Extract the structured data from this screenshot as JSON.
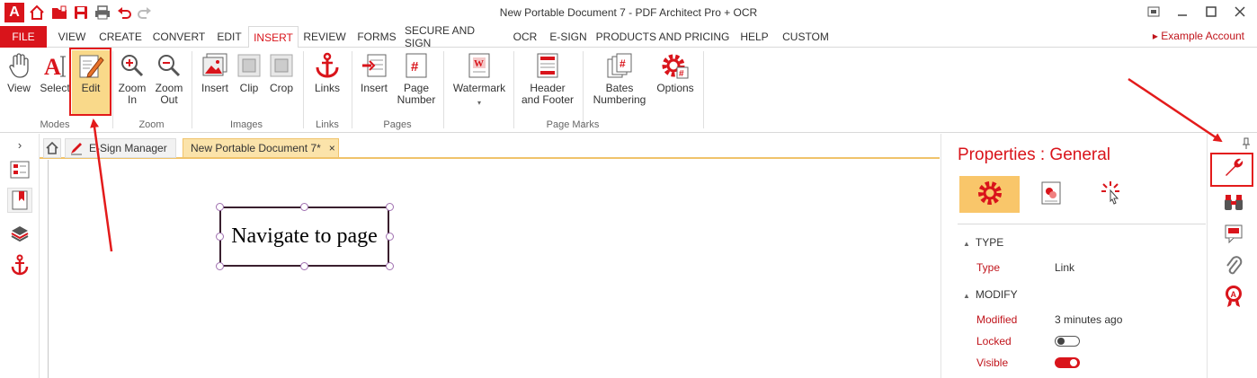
{
  "window": {
    "title": "New Portable Document 7    -   PDF Architect Pro + OCR",
    "logo_letter": "A"
  },
  "menu": {
    "file_label": "FILE",
    "tabs": [
      "VIEW",
      "CREATE",
      "CONVERT",
      "EDIT",
      "INSERT",
      "REVIEW",
      "FORMS",
      "SECURE AND SIGN",
      "OCR",
      "E-SIGN",
      "PRODUCTS AND PRICING",
      "HELP",
      "CUSTOM"
    ],
    "active_tab": "INSERT",
    "account_label": "▸ Example Account"
  },
  "ribbon": {
    "buttons": {
      "view": "View",
      "select": "Select",
      "edit": "Edit",
      "zoom_in_1": "Zoom",
      "zoom_in_2": "In",
      "zoom_out_1": "Zoom",
      "zoom_out_2": "Out",
      "insert_image": "Insert",
      "clip": "Clip",
      "crop": "Crop",
      "links": "Links",
      "insert_page": "Insert",
      "page_number_1": "Page",
      "page_number_2": "Number",
      "watermark": "Watermark",
      "header_footer_1": "Header",
      "header_footer_2": "and Footer",
      "bates_1": "Bates",
      "bates_2": "Numbering",
      "options": "Options"
    },
    "groups": {
      "modes": "Modes",
      "zoom": "Zoom",
      "images": "Images",
      "links": "Links",
      "pages": "Pages",
      "page_marks": "Page Marks"
    }
  },
  "doc_tabs": {
    "esign": "E-Sign Manager",
    "document": "New Portable Document 7*",
    "close_glyph": "×"
  },
  "document": {
    "link_text": "Navigate to page"
  },
  "properties": {
    "title": "Properties : General",
    "sections": {
      "type_head": "TYPE",
      "modify_head": "MODIFY"
    },
    "type_label": "Type",
    "type_value": "Link",
    "modified_label": "Modified",
    "modified_value": "3 minutes ago",
    "locked_label": "Locked",
    "locked": false,
    "visible_label": "Visible",
    "visible": true
  },
  "colors": {
    "brand": "#d9141b",
    "highlight": "#f9d98a",
    "annotation": "#e31b1b"
  },
  "icons": [
    "home-icon",
    "open-folder-icon",
    "save-icon",
    "print-icon",
    "undo-icon",
    "redo-icon",
    "hand-icon",
    "text-cursor-icon",
    "edit-pencil-icon",
    "zoom-in-icon",
    "zoom-out-icon",
    "image-icon",
    "anchor-icon",
    "page-number-icon",
    "watermark-icon",
    "gear-icon",
    "wrench-icon",
    "binoculars-icon",
    "comment-icon",
    "paperclip-icon",
    "seal-icon"
  ]
}
